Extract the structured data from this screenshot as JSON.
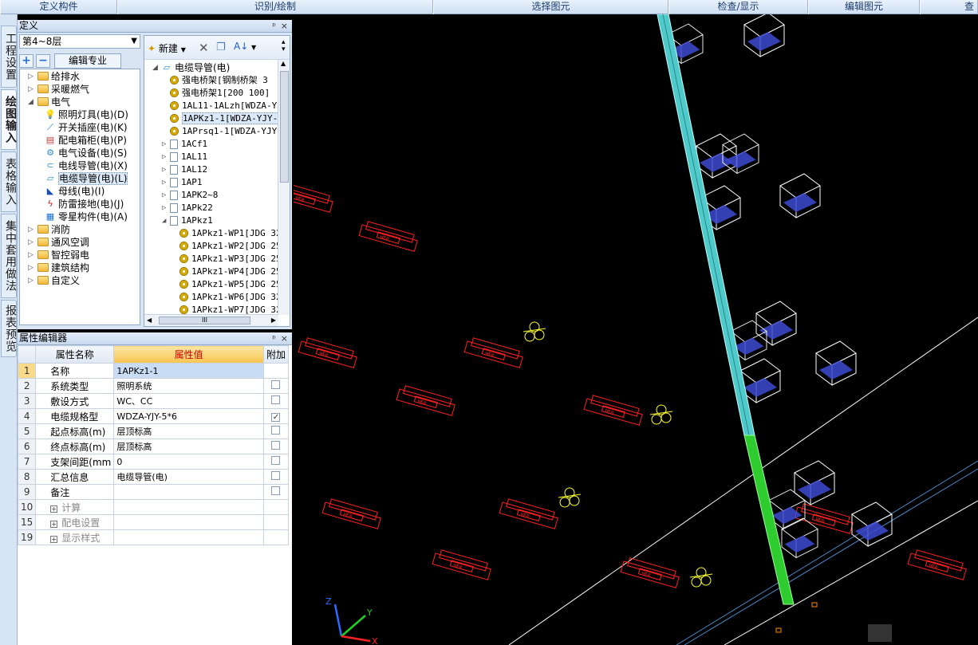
{
  "ribbon": [
    "定义构件",
    "识别/绘制",
    "选择图元",
    "检查/显示",
    "编辑图元",
    "查"
  ],
  "vtabs": [
    "工程设置",
    "绘图输入",
    "表格输入",
    "集中套用做法",
    "报表预览"
  ],
  "def_pane": {
    "title": "定义",
    "pin": "ᵖ",
    "close": "×"
  },
  "floor": "第4~8层",
  "edit_spec": "编辑专业",
  "tree_left": {
    "items": [
      {
        "label": "给排水",
        "icon": "folder"
      },
      {
        "label": "采暖燃气",
        "icon": "folder"
      },
      {
        "label": "电气",
        "icon": "folder"
      },
      {
        "label": "照明灯具(电)(D)",
        "icon": "bulb-icon"
      },
      {
        "label": "开关插座(电)(K)",
        "icon": "switch-icon"
      },
      {
        "label": "配电箱柜(电)(P)",
        "icon": "cabinet-icon"
      },
      {
        "label": "电气设备(电)(S)",
        "icon": "device-icon"
      },
      {
        "label": "电线导管(电)(X)",
        "icon": "conduit-icon"
      },
      {
        "label": "电缆导管(电)(L)",
        "icon": "cable-conduit-icon"
      },
      {
        "label": "母线(电)(I)",
        "icon": "busbar-icon"
      },
      {
        "label": "防雷接地(电)(J)",
        "icon": "lightning-icon"
      },
      {
        "label": "零星构件(电)(A)",
        "icon": "grid-icon"
      },
      {
        "label": "消防",
        "icon": "folder"
      },
      {
        "label": "通风空调",
        "icon": "folder"
      },
      {
        "label": "智控弱电",
        "icon": "folder"
      },
      {
        "label": "建筑结构",
        "icon": "folder"
      },
      {
        "label": "自定义",
        "icon": "folder"
      }
    ]
  },
  "tree_right": {
    "new_label": "新建",
    "root": "电缆导管(电)",
    "items": [
      {
        "label": "强电桥架[钢制桥架 3",
        "kind": "gear"
      },
      {
        "label": "强电桥架1[200 100]",
        "kind": "gear"
      },
      {
        "label": "1AL11-1ALzh[WDZA-YJ",
        "kind": "gear"
      },
      {
        "label": "1APKz1-1[WDZA-YJY-5",
        "kind": "gear"
      },
      {
        "label": "1APrsq1-1[WDZA-YJY-",
        "kind": "gear"
      },
      {
        "label": "1ACf1",
        "kind": "doc"
      },
      {
        "label": "1AL11",
        "kind": "doc"
      },
      {
        "label": "1AL12",
        "kind": "doc"
      },
      {
        "label": "1AP1",
        "kind": "doc"
      },
      {
        "label": "1APK2~8",
        "kind": "doc"
      },
      {
        "label": "1APk22",
        "kind": "doc"
      },
      {
        "label": "1APkz1",
        "kind": "doc"
      },
      {
        "label": "1APkz1-WP1[JDG 32",
        "kind": "gear"
      },
      {
        "label": "1APkz1-WP2[JDG 25",
        "kind": "gear"
      },
      {
        "label": "1APkz1-WP3[JDG 25",
        "kind": "gear"
      },
      {
        "label": "1APkz1-WP4[JDG 25",
        "kind": "gear"
      },
      {
        "label": "1APkz1-WP5[JDG 25",
        "kind": "gear"
      },
      {
        "label": "1APkz1-WP6[JDG 32",
        "kind": "gear"
      },
      {
        "label": "1APkz1-WP7[JDG 32",
        "kind": "gear"
      }
    ],
    "hscroll": "III"
  },
  "prop_pane": {
    "title": "属性编辑器",
    "pin": "ᵖ",
    "close": "×",
    "headers": [
      "属性名称",
      "属性值",
      "附加"
    ],
    "rows": [
      {
        "n": "1",
        "name": "名称",
        "value": "1APKz1-1",
        "chk": null
      },
      {
        "n": "2",
        "name": "系统类型",
        "value": "照明系统",
        "chk": false
      },
      {
        "n": "3",
        "name": "敷设方式",
        "value": "WC、CC",
        "chk": false
      },
      {
        "n": "4",
        "name": "电缆规格型",
        "value": "WDZA-YJY-5*6",
        "chk": true
      },
      {
        "n": "5",
        "name": "起点标高(m)",
        "value": "层顶标高",
        "chk": false
      },
      {
        "n": "6",
        "name": "终点标高(m)",
        "value": "层顶标高",
        "chk": false
      },
      {
        "n": "7",
        "name": "支架间距(mm",
        "value": "0",
        "chk": false
      },
      {
        "n": "8",
        "name": "汇总信息",
        "value": "电缆导管(电)",
        "chk": false
      },
      {
        "n": "9",
        "name": "备注",
        "value": "",
        "chk": false
      },
      {
        "n": "10",
        "name": "计算",
        "value": "",
        "chk": null,
        "group": true
      },
      {
        "n": "15",
        "name": "配电设置",
        "value": "",
        "chk": null,
        "group": true
      },
      {
        "n": "19",
        "name": "显示样式",
        "value": "",
        "chk": null,
        "group": true
      }
    ]
  },
  "canvas": {
    "axis_labels": {
      "z": "Z",
      "y": "Y",
      "x": "X"
    },
    "colors": {
      "bg": "#000000",
      "fixture": "#ff2020",
      "box": "#ffffff",
      "conduit": "#4fc9c9",
      "conduit2": "#2ecc2e",
      "label": "#ffff33"
    },
    "fixture_text": "HEA"
  }
}
